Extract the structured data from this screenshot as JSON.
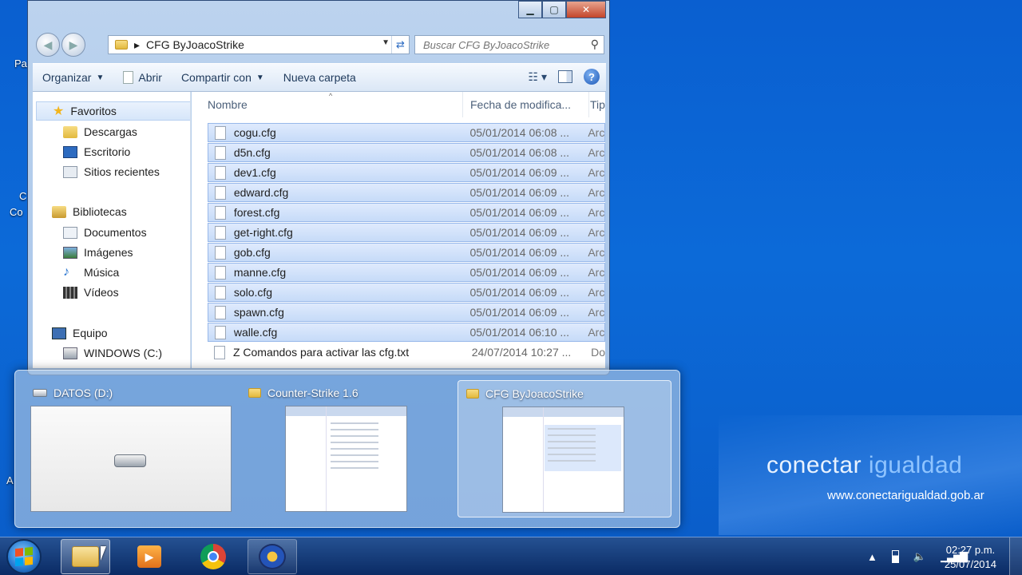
{
  "window": {
    "address": "CFG ByJoacoStrike",
    "search_placeholder": "Buscar CFG ByJoacoStrike"
  },
  "toolbar": {
    "organize": "Organizar",
    "open": "Abrir",
    "share": "Compartir con",
    "new_folder": "Nueva carpeta"
  },
  "nav": {
    "favorites": "Favoritos",
    "downloads": "Descargas",
    "desktop": "Escritorio",
    "recent": "Sitios recientes",
    "libraries": "Bibliotecas",
    "documents": "Documentos",
    "images": "Imágenes",
    "music": "Música",
    "videos": "Vídeos",
    "computer": "Equipo",
    "drive_c": "WINDOWS (C:)"
  },
  "columns": {
    "name": "Nombre",
    "date": "Fecha de modifica...",
    "type": "Tip"
  },
  "files": [
    {
      "name": "cogu.cfg",
      "date": "05/01/2014 06:08 ...",
      "type": "Arc"
    },
    {
      "name": "d5n.cfg",
      "date": "05/01/2014 06:08 ...",
      "type": "Arc"
    },
    {
      "name": "dev1.cfg",
      "date": "05/01/2014 06:09 ...",
      "type": "Arc"
    },
    {
      "name": "edward.cfg",
      "date": "05/01/2014 06:09 ...",
      "type": "Arc"
    },
    {
      "name": "forest.cfg",
      "date": "05/01/2014 06:09 ...",
      "type": "Arc"
    },
    {
      "name": "get-right.cfg",
      "date": "05/01/2014 06:09 ...",
      "type": "Arc"
    },
    {
      "name": "gob.cfg",
      "date": "05/01/2014 06:09 ...",
      "type": "Arc"
    },
    {
      "name": "manne.cfg",
      "date": "05/01/2014 06:09 ...",
      "type": "Arc"
    },
    {
      "name": "solo.cfg",
      "date": "05/01/2014 06:09 ...",
      "type": "Arc"
    },
    {
      "name": "spawn.cfg",
      "date": "05/01/2014 06:09 ...",
      "type": "Arc"
    },
    {
      "name": "walle.cfg",
      "date": "05/01/2014 06:10 ...",
      "type": "Arc"
    },
    {
      "name": "Z Comandos para  activar las cfg.txt",
      "date": "24/07/2014 10:27 ...",
      "type": "Do"
    }
  ],
  "peek": {
    "thumb1": "DATOS (D:)",
    "thumb2": "Counter-Strike 1.6",
    "thumb3": "CFG ByJoacoStrike"
  },
  "brand": {
    "word1": "conectar",
    "word2": "igualdad",
    "url": "www.conectarigualdad.gob.ar"
  },
  "clock": {
    "time": "02:27 p.m.",
    "date": "25/07/2014"
  },
  "desktop_icons": [
    "Pa",
    "C",
    "Co",
    "A"
  ],
  "colors": {
    "selection": "#cfe0fa",
    "desktop": "#0b63d0",
    "taskbar": "#1a3f7a"
  }
}
